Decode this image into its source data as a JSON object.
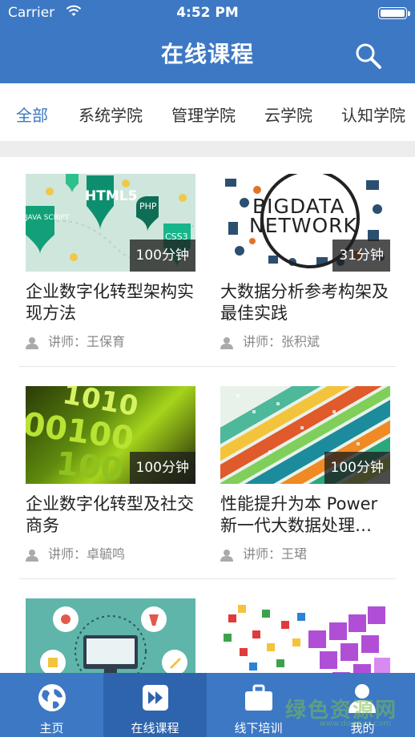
{
  "status_bar": {
    "carrier": "Carrier",
    "time": "4:52 PM"
  },
  "header": {
    "title": "在线课程"
  },
  "tabs": [
    "全部",
    "系统学院",
    "管理学院",
    "云学院",
    "认知学院"
  ],
  "courses": [
    {
      "title": "企业数字化转型架构实现方法",
      "duration": "100分钟",
      "teacher": "讲师：王保育",
      "thumb_text": [
        "HTML5",
        "PHP",
        "JAVA SCRIPT",
        "CSS3"
      ]
    },
    {
      "title": "大数据分析参考构架及最佳实践",
      "duration": "31分钟",
      "teacher": "讲师：张积斌",
      "thumb_text": [
        "BIGDATA",
        "NETWORK"
      ]
    },
    {
      "title": "企业数字化转型及社交商务",
      "duration": "100分钟",
      "teacher": "讲师：卓毓鸣",
      "thumb_text": [
        "1010",
        "00100",
        "100"
      ]
    },
    {
      "title": "性能提升为本 Power新一代大数据处理…",
      "duration": "100分钟",
      "teacher": "讲师：王珺"
    },
    {
      "title": "",
      "duration": "",
      "teacher": ""
    },
    {
      "title": "",
      "duration": "",
      "teacher": ""
    }
  ],
  "tabbar": [
    {
      "label": "主页",
      "icon": "globe-icon"
    },
    {
      "label": "在线课程",
      "icon": "play-forward-icon"
    },
    {
      "label": "线下培训",
      "icon": "briefcase-icon"
    },
    {
      "label": "我的",
      "icon": "person-icon"
    }
  ],
  "watermark": {
    "text": "绿色资源网",
    "sub": "www.downcc.com"
  },
  "colors": {
    "primary": "#3d78c4",
    "active_tabbar": "#2e64ad",
    "active_tab_text": "#3d78c4"
  }
}
